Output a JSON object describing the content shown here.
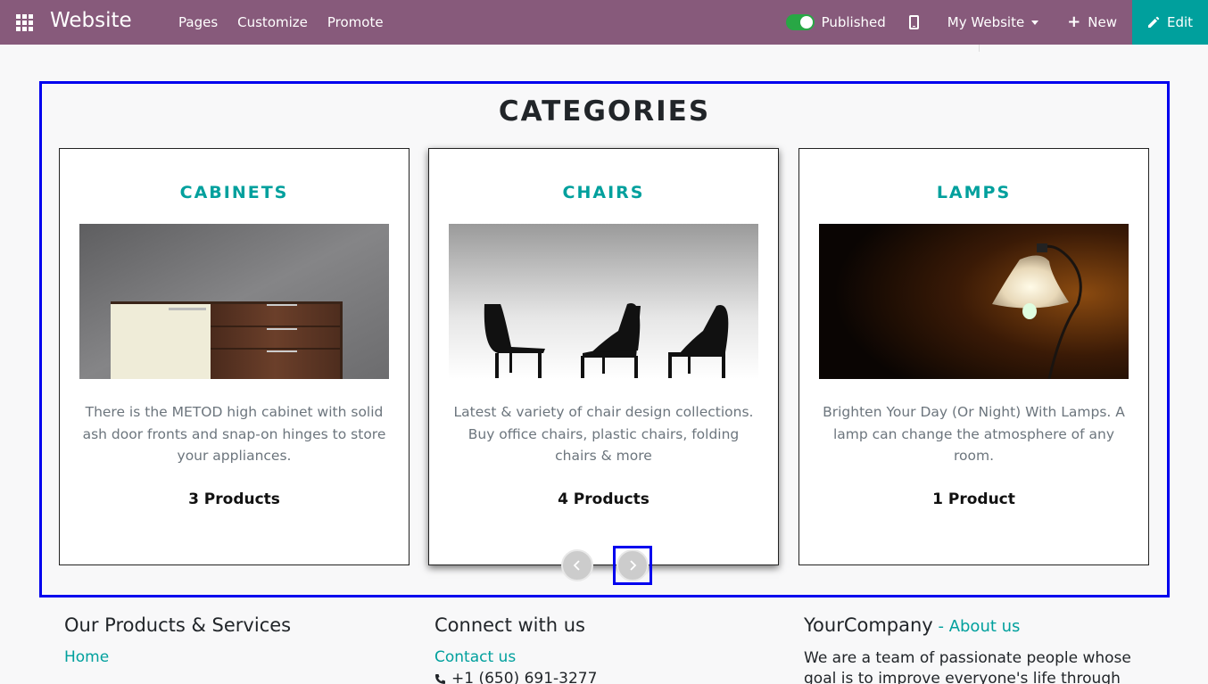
{
  "navbar": {
    "brand": "Website",
    "menu": [
      "Pages",
      "Customize",
      "Promote"
    ],
    "published_label": "Published",
    "website_label": "My Website",
    "new_label": "New",
    "edit_label": "Edit",
    "colors": {
      "bar": "#875a7b",
      "edit": "#00a09d",
      "toggle": "#28a745"
    }
  },
  "section": {
    "title": "CATEGORIES",
    "cards": [
      {
        "title": "CABINETS",
        "image": "cabinet-image",
        "description": "There is the METOD high cabinet with solid ash door fronts and snap-on hinges to store your appliances.",
        "count": "3 Products"
      },
      {
        "title": "CHAIRS",
        "image": "chairs-image",
        "description": "Latest & variety of chair design collections. Buy office chairs, plastic chairs, folding chairs & more",
        "count": "4 Products"
      },
      {
        "title": "LAMPS",
        "image": "lamp-image",
        "description": "Brighten Your Day (Or Night) With Lamps. A lamp can change the atmosphere of any room.",
        "count": "1 Product"
      }
    ],
    "carousel": {
      "prev_icon": "chevron-left-icon",
      "next_icon": "chevron-right-icon"
    }
  },
  "footer": {
    "col1": {
      "heading": "Our Products & Services",
      "link": "Home"
    },
    "col2": {
      "heading": "Connect with us",
      "link": "Contact us",
      "phone": "+1 (650) 691-3277"
    },
    "col3": {
      "heading": "YourCompany",
      "about": "About us",
      "separator": " - ",
      "text": "We are a team of passionate people whose goal is to improve everyone's life through"
    }
  }
}
